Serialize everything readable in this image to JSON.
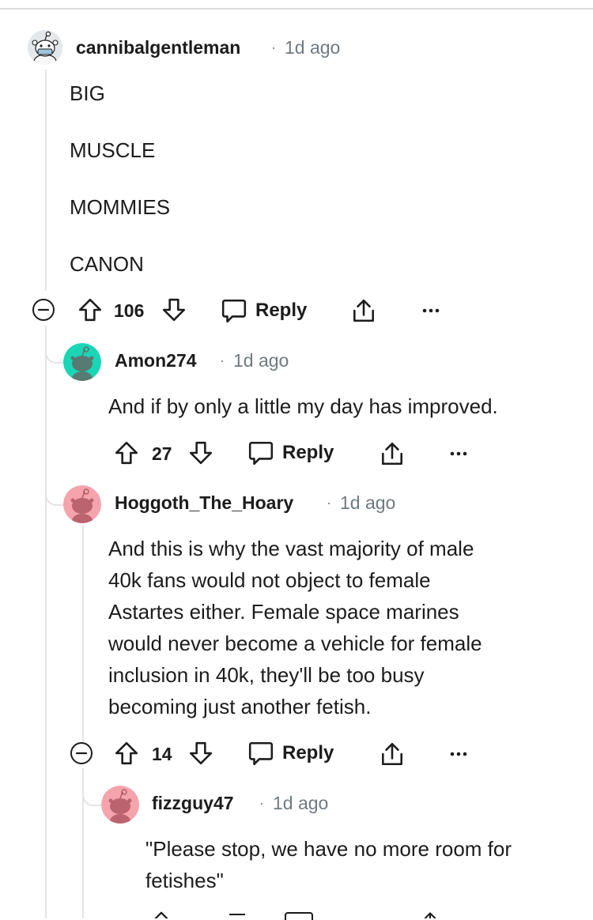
{
  "comments": [
    {
      "user": "cannibalgentleman",
      "time": "1d ago",
      "paragraphs": [
        "BIG",
        "MUSCLE",
        "MOMMIES",
        "CANON"
      ],
      "votes": "106",
      "reply_label": "Reply",
      "avatar_color": "#dfe4e8"
    },
    {
      "user": "Amon274",
      "time": "1d ago",
      "text": "And if by only a little my day has improved.",
      "votes": "27",
      "reply_label": "Reply",
      "avatar_color": "#1ad6b6"
    },
    {
      "user": "Hoggoth_The_Hoary",
      "time": "1d ago",
      "lines": [
        "And this is why the vast majority of male",
        "40k fans would not object to female",
        "Astartes either. Female space marines",
        "would never become a vehicle for female",
        "inclusion in 40k, they'll be too busy",
        "becoming just another fetish."
      ],
      "votes": "14",
      "reply_label": "Reply",
      "avatar_color": "#f5a3ad"
    },
    {
      "user": "fizzguy47",
      "time": "1d ago",
      "lines": [
        "\"Please stop, we have no more room for",
        "fetishes\""
      ],
      "avatar_color": "#f5a3ad"
    }
  ],
  "icons": [
    "collapse-icon",
    "upvote-icon",
    "downvote-icon",
    "reply-icon",
    "share-icon",
    "more-icon"
  ],
  "separator": "·"
}
